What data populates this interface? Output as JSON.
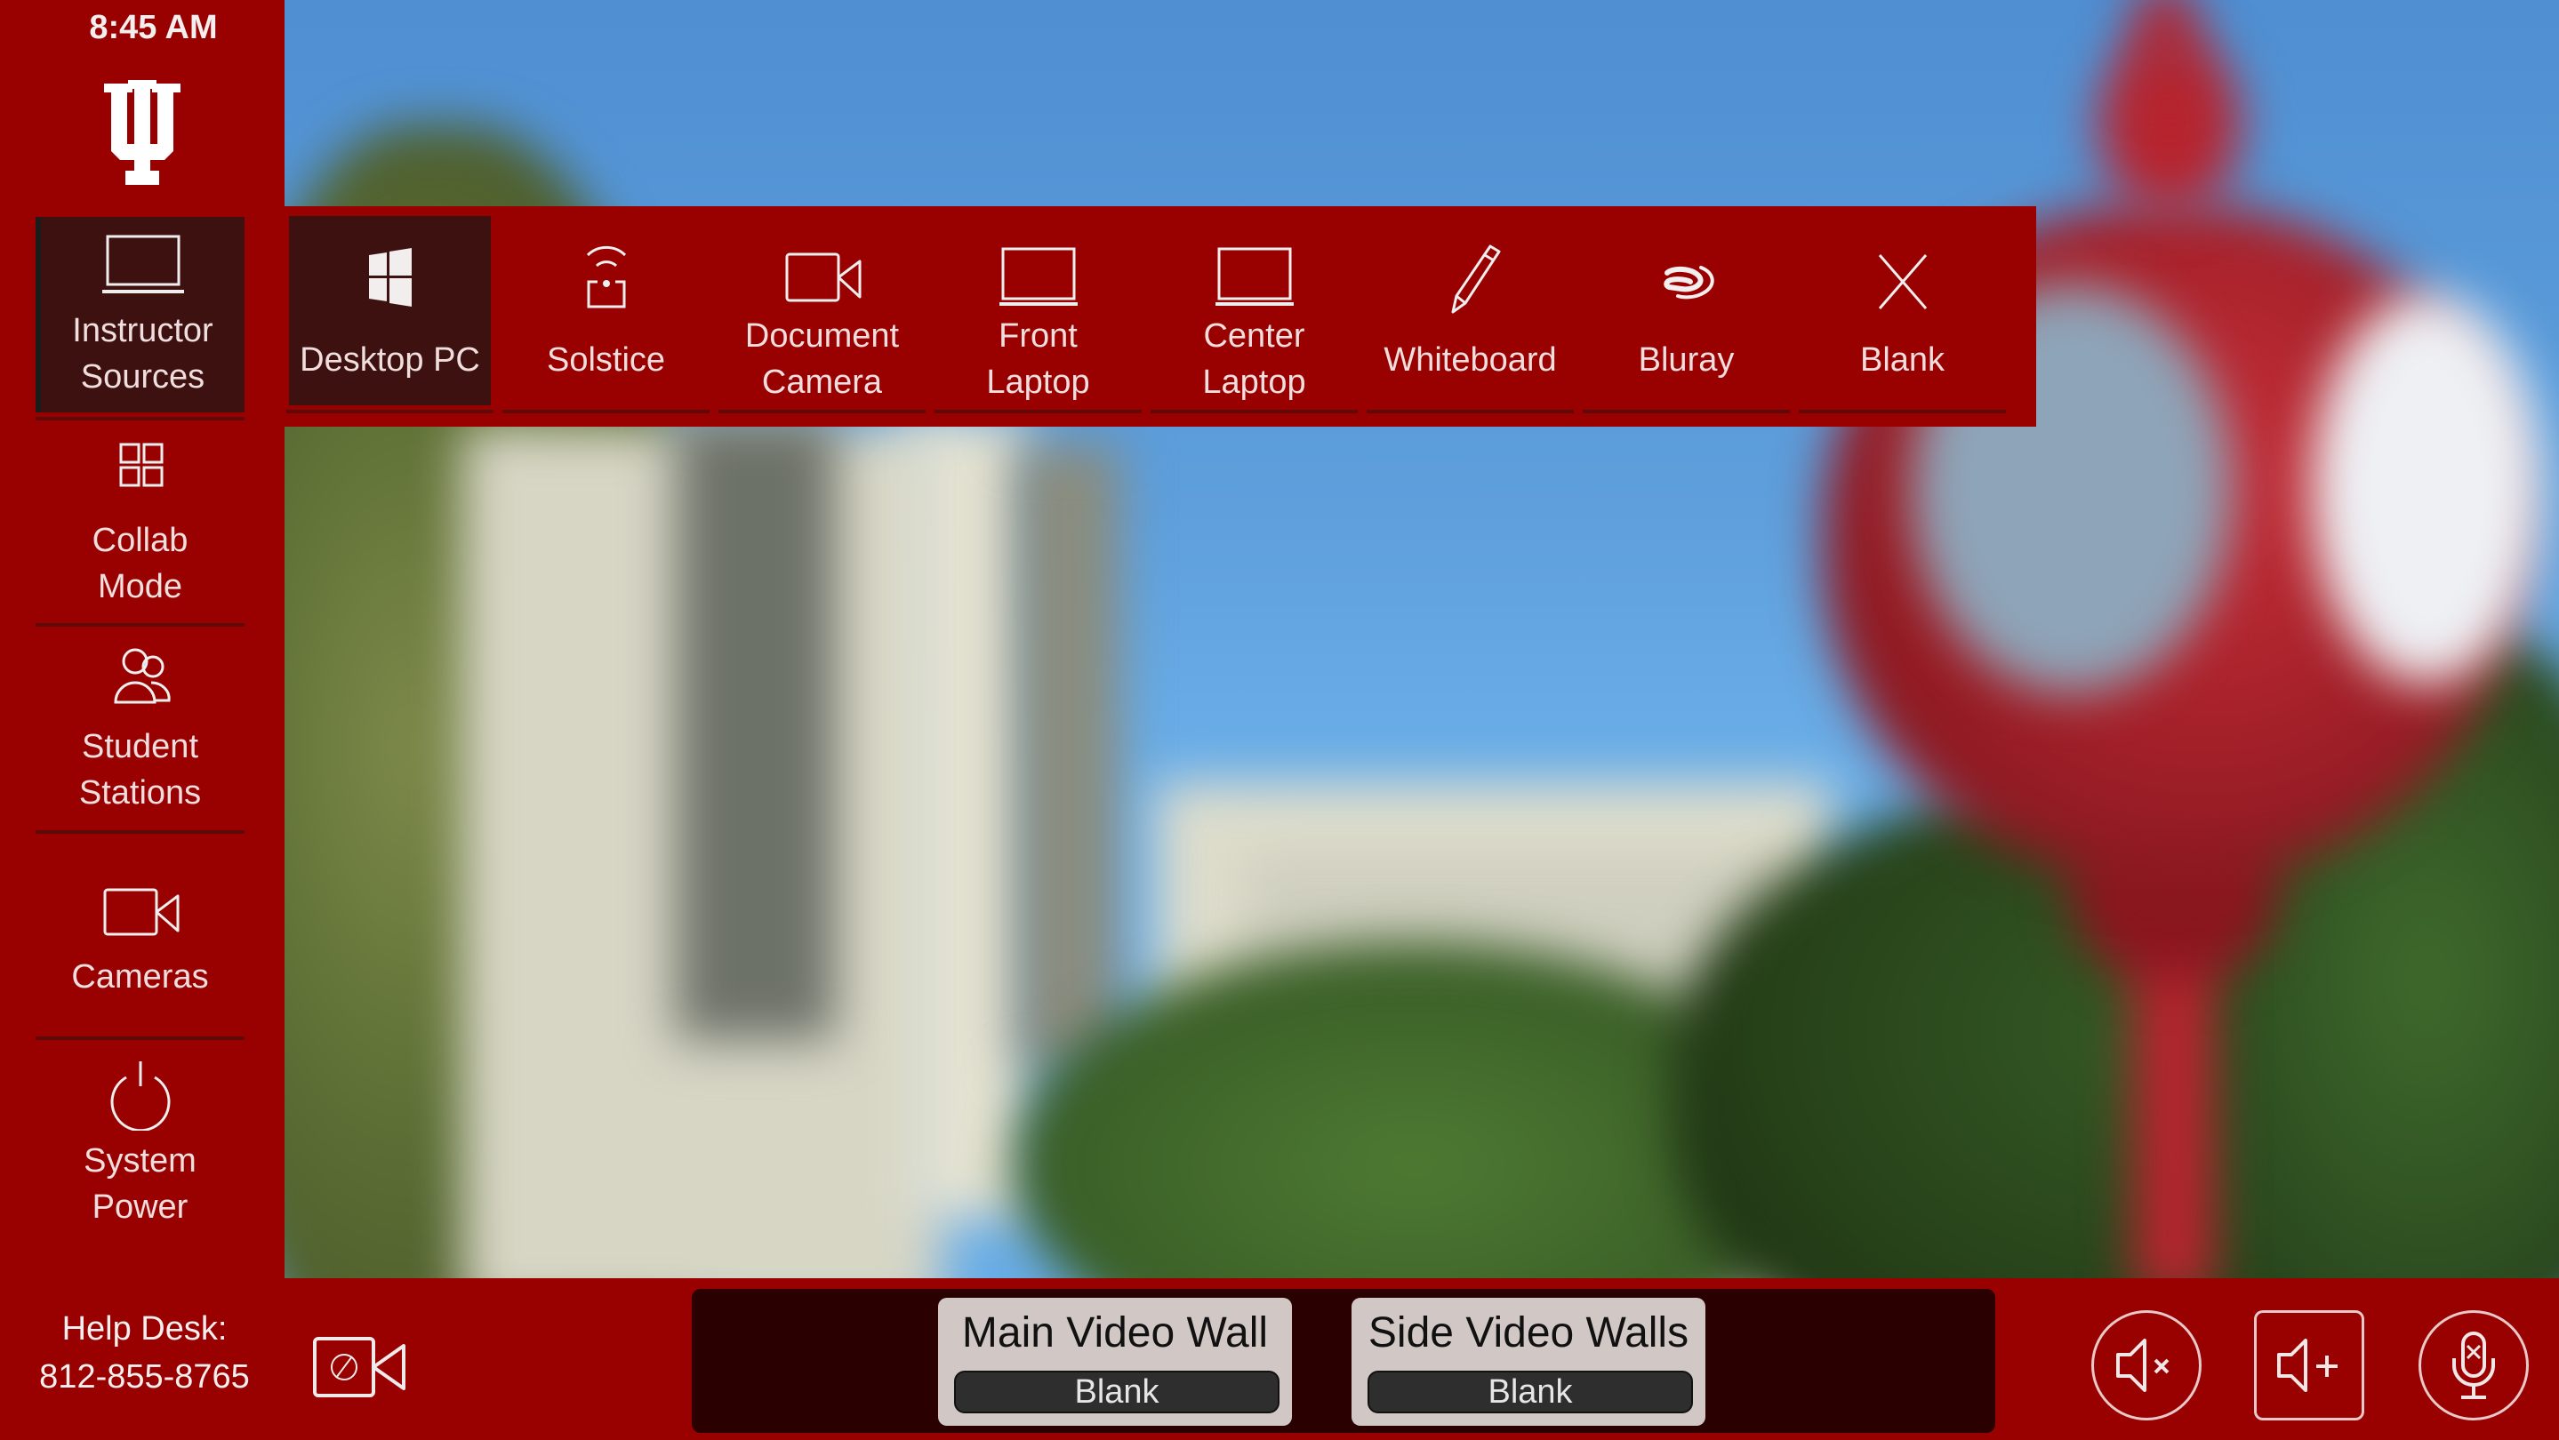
{
  "status": {
    "time": "8:45 AM"
  },
  "brand": {
    "logo": "indiana-university-trident-logo",
    "primary_color": "#990000",
    "active_tile_color": "#3e1111"
  },
  "sidebar": {
    "items": [
      {
        "id": "instructor-sources",
        "label_line1": "Instructor",
        "label_line2": "Sources",
        "icon": "laptop-icon",
        "active": true
      },
      {
        "id": "collab-mode",
        "label_line1": "Collab",
        "label_line2": "Mode",
        "icon": "grid-icon",
        "active": false
      },
      {
        "id": "student-stations",
        "label_line1": "Student",
        "label_line2": "Stations",
        "icon": "users-icon",
        "active": false
      },
      {
        "id": "cameras",
        "label_line1": "Cameras",
        "label_line2": "",
        "icon": "video-camera-icon",
        "active": false
      },
      {
        "id": "system-power",
        "label_line1": "System",
        "label_line2": "Power",
        "icon": "power-icon",
        "active": false
      }
    ]
  },
  "sources": {
    "items": [
      {
        "id": "desktop-pc",
        "label_line1": "Desktop PC",
        "label_line2": "",
        "icon": "windows-icon",
        "active": true
      },
      {
        "id": "solstice",
        "label_line1": "Solstice",
        "label_line2": "",
        "icon": "wireless-share-icon",
        "active": false
      },
      {
        "id": "document-camera",
        "label_line1": "Document",
        "label_line2": "Camera",
        "icon": "video-camera-icon",
        "active": false
      },
      {
        "id": "front-laptop",
        "label_line1": "Front",
        "label_line2": "Laptop",
        "icon": "laptop-icon",
        "active": false
      },
      {
        "id": "center-laptop",
        "label_line1": "Center",
        "label_line2": "Laptop",
        "icon": "laptop-icon",
        "active": false
      },
      {
        "id": "whiteboard",
        "label_line1": "Whiteboard",
        "label_line2": "",
        "icon": "pencil-icon",
        "active": false
      },
      {
        "id": "bluray",
        "label_line1": "Bluray",
        "label_line2": "",
        "icon": "bluray-icon",
        "active": false
      },
      {
        "id": "blank",
        "label_line1": "Blank",
        "label_line2": "",
        "icon": "close-icon",
        "active": false
      }
    ]
  },
  "footer": {
    "helpdesk_label": "Help Desk:",
    "helpdesk_phone": "812-855-8765",
    "privacy_camera_icon": "camera-privacy-off-icon",
    "displays": [
      {
        "name": "Main Video Wall",
        "status": "Blank"
      },
      {
        "name": "Side Video Walls",
        "status": "Blank"
      }
    ],
    "audio_controls": [
      {
        "id": "volume-mute",
        "icon": "speaker-mute-icon"
      },
      {
        "id": "volume-up",
        "icon": "speaker-plus-icon"
      },
      {
        "id": "mic-mute",
        "icon": "microphone-mute-icon"
      }
    ]
  }
}
